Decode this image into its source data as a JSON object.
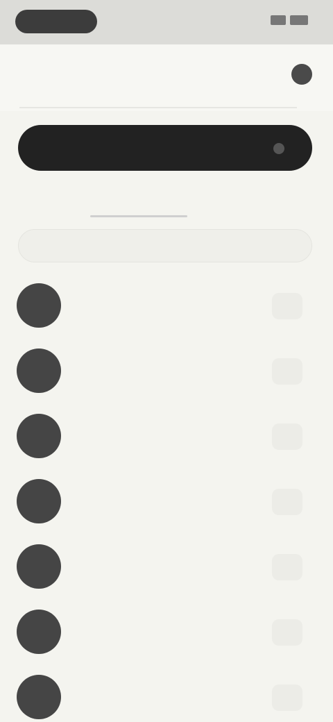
{
  "status_bar": {
    "time": "",
    "icons": [
      "signal-icon",
      "battery-icon"
    ]
  },
  "header": {
    "title": "",
    "icon": "settings-icon"
  },
  "primary_action": {
    "label": "",
    "icon": "arrow-icon"
  },
  "tabs": [
    {
      "label": ""
    },
    {
      "label": ""
    }
  ],
  "search": {
    "placeholder": ""
  },
  "list": [
    {
      "name": "",
      "subtitle": ""
    },
    {
      "name": "",
      "subtitle": ""
    },
    {
      "name": "",
      "subtitle": ""
    },
    {
      "name": "",
      "subtitle": ""
    },
    {
      "name": "",
      "subtitle": ""
    },
    {
      "name": "",
      "subtitle": ""
    },
    {
      "name": "",
      "subtitle": ""
    }
  ],
  "colors": {
    "background": "#f4f4ef",
    "button": "#222222",
    "avatar": "#454545"
  }
}
